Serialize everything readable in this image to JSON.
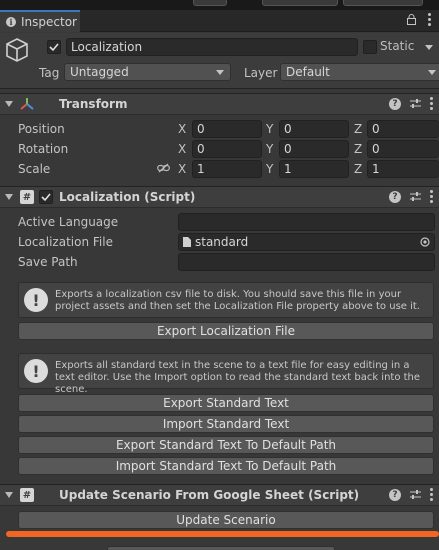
{
  "tab": {
    "label": "Inspector"
  },
  "object": {
    "name": "Localization",
    "static_label": "Static",
    "tag_label": "Tag",
    "tag_value": "Untagged",
    "layer_label": "Layer",
    "layer_value": "Default"
  },
  "transform": {
    "title": "Transform",
    "rows": [
      {
        "label": "Position",
        "x": "0",
        "y": "0",
        "z": "0"
      },
      {
        "label": "Rotation",
        "x": "0",
        "y": "0",
        "z": "0"
      },
      {
        "label": "Scale",
        "x": "1",
        "y": "1",
        "z": "1"
      }
    ],
    "axis": {
      "x": "X",
      "y": "Y",
      "z": "Z"
    }
  },
  "localization": {
    "title": "Localization (Script)",
    "fields": {
      "active_language_label": "Active Language",
      "active_language_value": "",
      "localization_file_label": "Localization File",
      "localization_file_value": "standard",
      "save_path_label": "Save Path",
      "save_path_value": ""
    },
    "help1": "Exports a localization csv file to disk. You should save this file in your project assets and then set the Localization File property above to use it.",
    "export_file_button": "Export Localization File",
    "help2": "Exports all standard text in the scene to a text file for easy editing in a text editor. Use the Import option to read the standard text back into the scene.",
    "buttons": [
      "Export Standard Text",
      "Import Standard Text",
      "Export Standard Text To Default Path",
      "Import Standard Text To Default Path"
    ]
  },
  "update_scenario": {
    "title": "Update Scenario From Google Sheet (Script)",
    "button": "Update Scenario"
  },
  "colors": {
    "accent_tab": "#3a79bb",
    "progress": "#f26522"
  }
}
